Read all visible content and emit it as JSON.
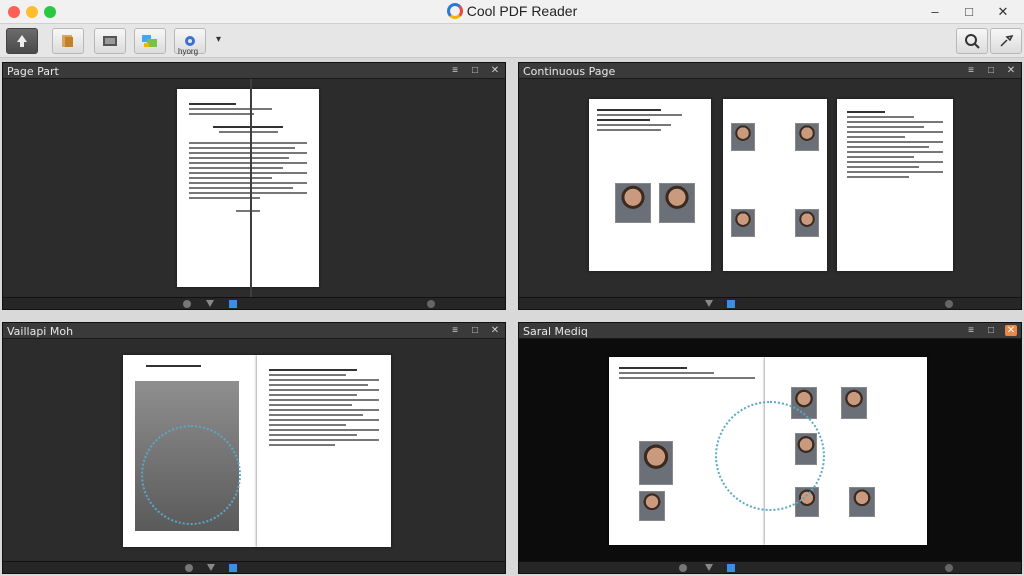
{
  "app": {
    "title": "Cool PDF Reader"
  },
  "window": {
    "minimize": "–",
    "maximize": "□",
    "close": "✕"
  },
  "toolbar": {
    "label": "hyorg",
    "dropdown": "▾"
  },
  "panels": [
    {
      "title": "Page Part"
    },
    {
      "title": "Continuous Page"
    },
    {
      "title": "Vaillapi Moh"
    },
    {
      "title": "Saral Mediq"
    }
  ],
  "panel_controls": {
    "menu": "≡",
    "restore": "□",
    "close": "✕"
  },
  "colors": {
    "accent": "#2b78d6",
    "panel_bg": "#2c2c2c",
    "orange_close": "#e8894a"
  }
}
